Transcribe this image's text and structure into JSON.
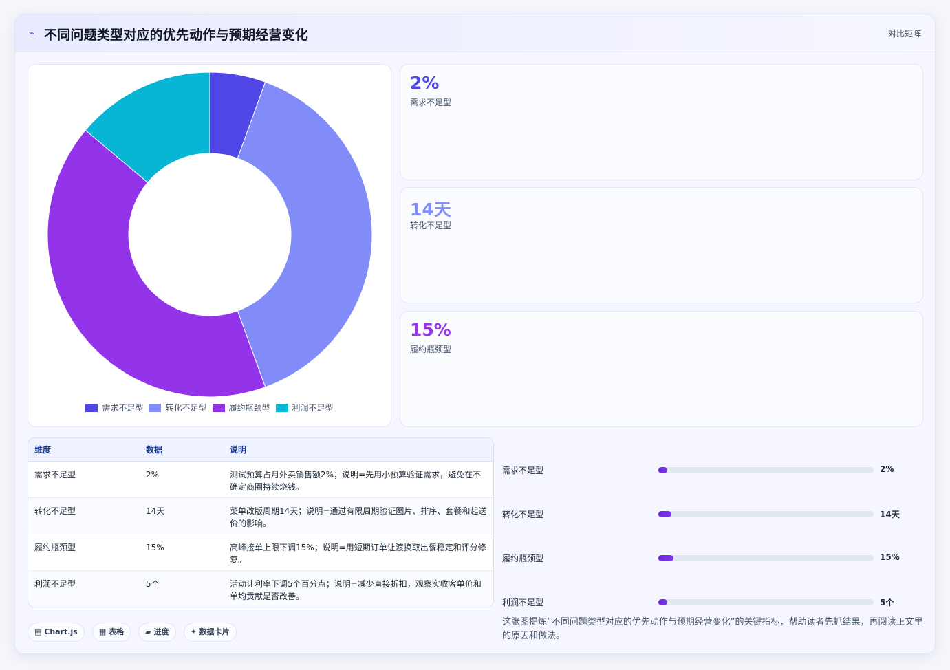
{
  "header": {
    "icon": "chart-line-icon",
    "title": "不同问题类型对应的优先动作与预期经营变化",
    "tag": "对比矩阵"
  },
  "chart_data": {
    "type": "pie",
    "donut": true,
    "categories": [
      "需求不足型",
      "转化不足型",
      "履约瓶颈型",
      "利润不足型"
    ],
    "values": [
      2,
      14,
      15,
      5
    ],
    "colors": [
      "#4f46e5",
      "#818cf8",
      "#9333ea",
      "#06b6d4"
    ],
    "legend": "bottom"
  },
  "stats": [
    {
      "value": "2%",
      "label": "需求不足型",
      "color": "#4f46e5"
    },
    {
      "value": "14天",
      "label": "转化不足型",
      "color": "#818cf8"
    },
    {
      "value": "15%",
      "label": "履约瓶颈型",
      "color": "#9333ea"
    }
  ],
  "table": {
    "headers": [
      "维度",
      "数据",
      "说明"
    ],
    "rows": [
      [
        "需求不足型",
        "2%",
        "测试预算占月外卖销售额2%；说明=先用小预算验证需求，避免在不确定商圈持续烧钱。"
      ],
      [
        "转化不足型",
        "14天",
        "菜单改版周期14天；说明=通过有限周期验证图片、排序、套餐和起送价的影响。"
      ],
      [
        "履约瓶颈型",
        "15%",
        "高峰接单上限下调15%；说明=用短期订单让渡换取出餐稳定和评分修复。"
      ],
      [
        "利润不足型",
        "5个",
        "活动让利率下调5个百分点；说明=减少直接折扣，观察实收客单价和单均贡献是否改善。"
      ]
    ]
  },
  "progress": [
    {
      "label": "需求不足型",
      "value": "2%",
      "fraction": 0.02
    },
    {
      "label": "转化不足型",
      "value": "14天",
      "fraction": 0.06
    },
    {
      "label": "履约瓶颈型",
      "value": "15%",
      "fraction": 0.07
    },
    {
      "label": "利润不足型",
      "value": "5个",
      "fraction": 0.02
    }
  ],
  "pills": [
    {
      "icon": "chart-icon",
      "glyph": "▤",
      "label": "Chart.js"
    },
    {
      "icon": "table-icon",
      "glyph": "▦",
      "label": "表格"
    },
    {
      "icon": "progress-icon",
      "glyph": "▰",
      "label": "进度"
    },
    {
      "icon": "sparkle-icon",
      "glyph": "✦",
      "label": "数据卡片"
    }
  ],
  "note": "这张图提炼“不同问题类型对应的优先动作与预期经营变化”的关键指标，帮助读者先抓结果，再阅读正文里的原因和做法。"
}
